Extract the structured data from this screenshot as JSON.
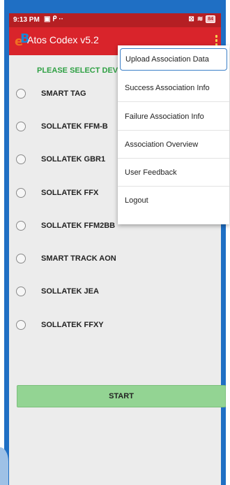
{
  "status_bar": {
    "time": "9:13 PM",
    "left_icons": [
      "notification-icon",
      "p-icon"
    ],
    "more": "··",
    "battery": "84"
  },
  "app_bar": {
    "logo_letters": "eB",
    "title": "Atos Codex v5.2",
    "overflow_icon": "more-vert-icon"
  },
  "main": {
    "heading": "PLEASE SELECT DEV",
    "options": [
      {
        "label": "SMART TAG"
      },
      {
        "label": "SOLLATEK FFM-B"
      },
      {
        "label": "SOLLATEK GBR1"
      },
      {
        "label": "SOLLATEK FFX"
      },
      {
        "label": "SOLLATEK FFM2BB"
      },
      {
        "label": "SMART TRACK AON"
      },
      {
        "label": "SOLLATEK JEA"
      },
      {
        "label": "SOLLATEK FFXY"
      }
    ],
    "start_label": "START"
  },
  "menu": {
    "items": [
      {
        "label": "Upload Association Data"
      },
      {
        "label": "Success Association Info"
      },
      {
        "label": "Failure Association Info"
      },
      {
        "label": "Association Overview"
      },
      {
        "label": "User Feedback"
      },
      {
        "label": "Logout"
      }
    ]
  },
  "colors": {
    "app_bar": "#d9242b",
    "status_bar": "#b51f23",
    "frame": "#1f6fc4",
    "heading": "#2ea043",
    "start_button": "#93d493",
    "menu_highlight": "#3b7fc8"
  }
}
